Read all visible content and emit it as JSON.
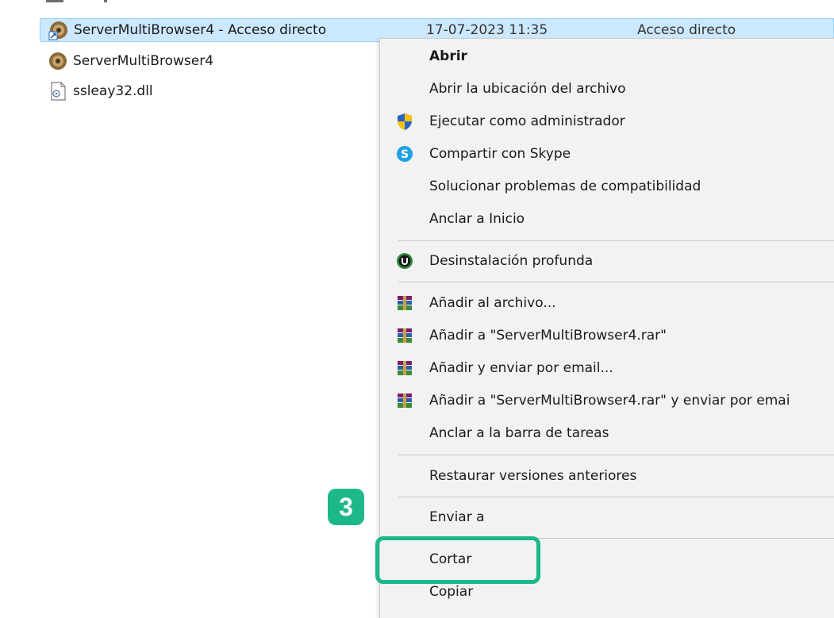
{
  "files": [
    {
      "name": "ServerMultiBrowser4 - Acceso directo",
      "date": "17-07-2023 11:35",
      "type": "Acceso directo",
      "icon": "shortcut-app-icon",
      "selected": true
    },
    {
      "name": "ServerMultiBrowser4",
      "icon": "app-icon"
    },
    {
      "name": "ssleay32.dll",
      "icon": "dll-file-icon"
    }
  ],
  "menu": {
    "items": [
      {
        "label": "Abrir",
        "bold": true,
        "icon": ""
      },
      {
        "label": "Abrir la ubicación del archivo",
        "icon": ""
      },
      {
        "label": "Ejecutar como administrador",
        "icon": "uac-shield-icon"
      },
      {
        "label": "Compartir con Skype",
        "icon": "skype-icon"
      },
      {
        "label": "Solucionar problemas de compatibilidad",
        "icon": ""
      },
      {
        "label": "Anclar a Inicio",
        "icon": ""
      },
      {
        "label": "Desinstalación profunda",
        "icon": "uninstaller-icon"
      },
      {
        "label": "Añadir al archivo...",
        "icon": "winrar-icon"
      },
      {
        "label": "Añadir a \"ServerMultiBrowser4.rar\"",
        "icon": "winrar-icon"
      },
      {
        "label": "Añadir y enviar por email...",
        "icon": "winrar-icon"
      },
      {
        "label": "Añadir a \"ServerMultiBrowser4.rar\" y enviar por emai",
        "icon": "winrar-icon"
      },
      {
        "label": "Anclar a la barra de tareas",
        "icon": ""
      },
      {
        "label": "Restaurar versiones anteriores",
        "icon": ""
      },
      {
        "label": "Enviar a",
        "icon": ""
      },
      {
        "label": "Cortar",
        "icon": ""
      },
      {
        "label": "Copiar",
        "icon": ""
      }
    ]
  },
  "annotation": {
    "step": "3",
    "color": "#1db88a"
  },
  "colors": {
    "selection": "#cce8ff",
    "menu_bg": "#f2f2f2"
  }
}
